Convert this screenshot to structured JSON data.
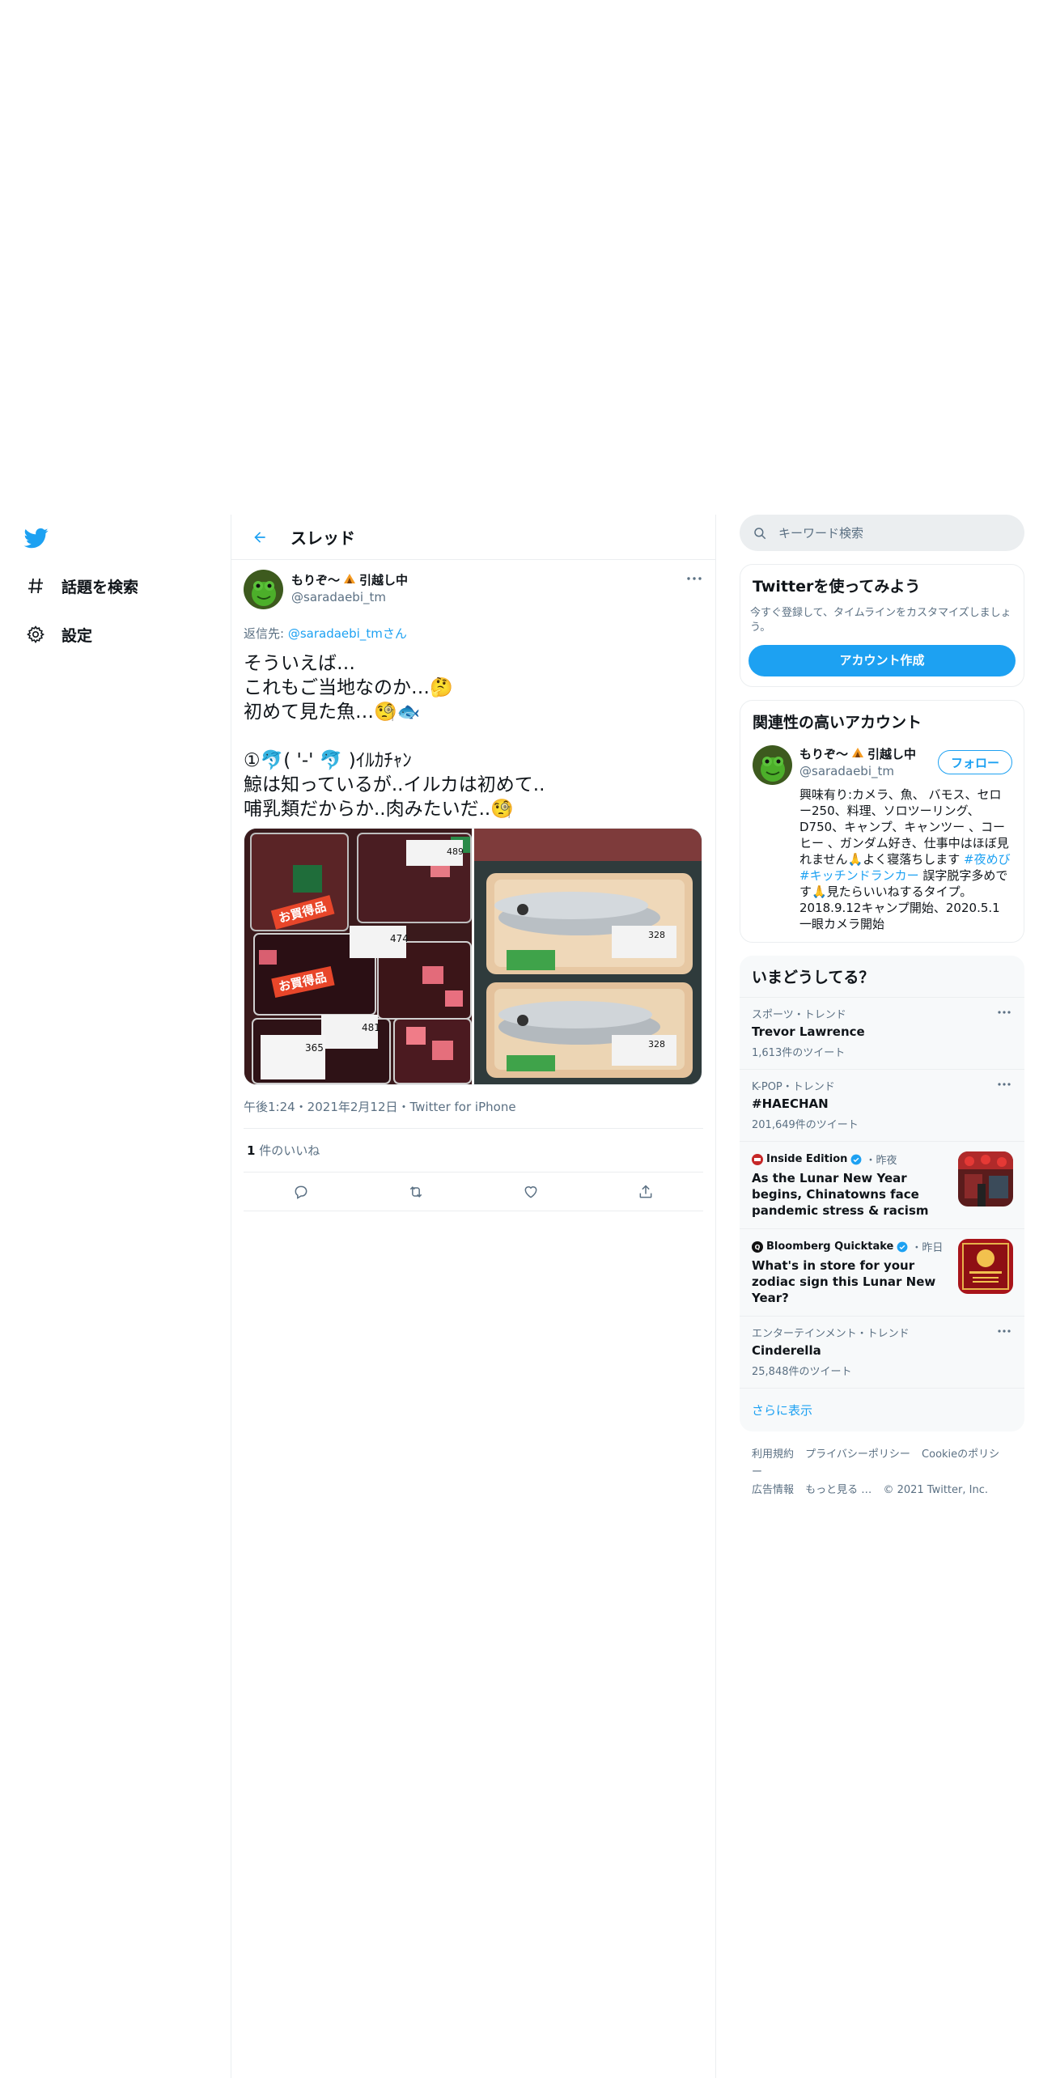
{
  "nav": {
    "items": [
      {
        "label": "話題を検索",
        "icon": "hashtag-icon"
      },
      {
        "label": "設定",
        "icon": "gear-icon"
      }
    ]
  },
  "header": {
    "title": "スレッド"
  },
  "tweet": {
    "display_name": "もりぞ〜",
    "display_suffix": "引越し中",
    "username": "@saradaebi_tm",
    "reply_prefix": "返信先: ",
    "reply_handle": "@saradaebi_tmさん",
    "text": "そういえば…\nこれもご当地なのか…🤔\n初めて見た魚…🧐🐟\n\n①🐬( '-' 🐬 )ｲﾙｶﾁｬﾝ\n鯨は知っているが..イルカは初めて..\n哺乳類だからか..肉みたいだ..🧐",
    "photo_tags": [
      "お買得品",
      "お買得品"
    ],
    "photo_prices": [
      "474",
      "489",
      "481",
      "365",
      "328",
      "328"
    ],
    "timestamp": "午後1:24・2021年2月12日・Twitter for iPhone",
    "likes_count": "1",
    "likes_label": " 件のいいね"
  },
  "search": {
    "placeholder": "キーワード検索"
  },
  "signup": {
    "title": "Twitterを使ってみよう",
    "subtitle": "今すぐ登録して、タイムラインをカスタマイズしましょう。",
    "button": "アカウント作成"
  },
  "relevant": {
    "title": "関連性の高いアカウント",
    "display_name": "もりぞ〜",
    "display_suffix": "引越し中",
    "username": "@saradaebi_tm",
    "follow": "フォロー",
    "bio_1": "興味有り:カメラ、魚、 バモス、セロー250、料理、ソロツーリング、D750、キャンプ、キャンツー 、コーヒー 、ガンダム好き、仕事中はほぼ見れません🙏よく寝落ちします ",
    "bio_tag1": "#夜めび",
    "bio_space": " ",
    "bio_tag2": "#キッチンドランカー",
    "bio_2": " 誤字脱字多めです🙏見たらいいねするタイプ。2018.9.12キャンプ開始、2020.5.1 一眼カメラ開始"
  },
  "trends": {
    "title": "いまどうしてる？",
    "items": [
      {
        "meta": "スポーツ・トレンド",
        "name": "Trevor Lawrence",
        "count": "1,613件のツイート"
      },
      {
        "meta": "K-POP・トレンド",
        "name": "#HAECHAN",
        "count": "201,649件のツイート"
      }
    ],
    "news": [
      {
        "source": "Inside Edition",
        "time": "・昨夜",
        "headline": "As the Lunar New Year begins, Chinatowns face pandemic stress & racism"
      },
      {
        "source": "Bloomberg Quicktake",
        "time": "・昨日",
        "headline": "What's in store for your zodiac sign this Lunar New Year?"
      }
    ],
    "last": {
      "meta": "エンターテインメント・トレンド",
      "name": "Cinderella",
      "count": "25,848件のツイート"
    },
    "show_more": "さらに表示"
  },
  "footer": {
    "links": [
      "利用規約",
      "プライバシーポリシー",
      "Cookieのポリシー",
      "広告情報",
      "もっと見る …",
      "© 2021 Twitter, Inc."
    ]
  },
  "colors": {
    "accent": "#1da1f2",
    "text": "#0f1419",
    "muted": "#5b7083",
    "border": "#ebeef0",
    "panel": "#f7f9fa"
  }
}
